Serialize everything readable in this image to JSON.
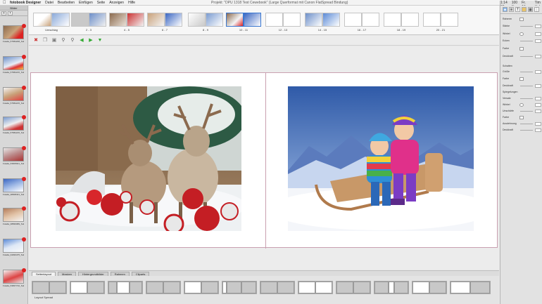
{
  "menubar": {
    "app": "fotobook Designer",
    "items": [
      "Datei",
      "Bearbeiten",
      "Einfügen",
      "Seite",
      "Anzeigen",
      "Hilfe"
    ],
    "window_title": "Projekt: \"DPU 1318 Test Cewebook\" (Large Querformat mit Canon FlatSpread Bindung)",
    "status": [
      "1:14 00",
      "100 %",
      "Fr. 13. Okt. 13:30",
      "Tim Helpers"
    ]
  },
  "left": {
    "header": "Bilder",
    "thumbs": [
      {
        "label": "Fotalia_57584208_Subsc.."
      },
      {
        "label": "Fotalia_57584215_Subsc.."
      },
      {
        "label": "Fotalia_57584215_Subsc.."
      },
      {
        "label": "Fotalia_57584215_Subsc.."
      },
      {
        "label": "Fotalia_53605941_Subsc.."
      },
      {
        "label": "Fotalia_38008441_Subsc.."
      },
      {
        "label": "Fotalia_38836089_Subsc.."
      },
      {
        "label": "Fotalia_34093475_Subsc.."
      },
      {
        "label": "Fotalia_53837710_Subsc.."
      }
    ]
  },
  "strip": {
    "spreads": [
      "Umschlag",
      "2 - 3",
      "4 - 5",
      "6 - 7",
      "8 - 9",
      "10 - 11",
      "12 - 13",
      "14 - 15",
      "16 - 17",
      "18 - 19",
      "20 - 21"
    ]
  },
  "tabs": [
    "Seitenlayout",
    "Masken",
    "Hintergrundbilder",
    "Rahmen",
    "Cliparts"
  ],
  "layouts": {
    "label": "Layout Spread"
  },
  "inspector": {
    "props": [
      "Rahmen",
      "Stärke",
      "Winkel",
      "Ecken",
      "Farbe",
      "Deckkraft",
      "Schatten",
      "Größe",
      "Farbe",
      "Deckkraft",
      "Spiegelungen",
      "Versatz",
      "Winkel",
      "Unschärfe",
      "Farbe",
      "Ausdehnung",
      "Deckkraft"
    ]
  }
}
